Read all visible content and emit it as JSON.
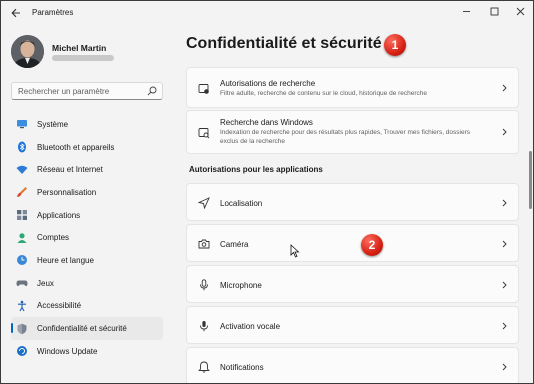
{
  "window": {
    "title": "Paramètres"
  },
  "user": {
    "name": "Michel Martin"
  },
  "search": {
    "placeholder": "Rechercher un paramètre"
  },
  "sidebar": {
    "items": [
      {
        "label": "Système",
        "icon": "monitor-icon"
      },
      {
        "label": "Bluetooth et appareils",
        "icon": "bluetooth-icon"
      },
      {
        "label": "Réseau et Internet",
        "icon": "wifi-icon"
      },
      {
        "label": "Personnalisation",
        "icon": "brush-icon"
      },
      {
        "label": "Applications",
        "icon": "apps-icon"
      },
      {
        "label": "Comptes",
        "icon": "account-icon"
      },
      {
        "label": "Heure et langue",
        "icon": "globe-clock-icon"
      },
      {
        "label": "Jeux",
        "icon": "gamepad-icon"
      },
      {
        "label": "Accessibilité",
        "icon": "accessibility-icon"
      },
      {
        "label": "Confidentialité et sécurité",
        "icon": "shield-icon",
        "active": true
      },
      {
        "label": "Windows Update",
        "icon": "update-icon"
      }
    ]
  },
  "main": {
    "title": "Confidentialité et sécurité",
    "top_cards": [
      {
        "title": "Autorisations de recherche",
        "subtitle": "Filtre adulte, recherche de contenu sur le cloud, historique de recherche",
        "icon": "search-permissions-icon"
      },
      {
        "title": "Recherche dans Windows",
        "subtitle": "Indexation de recherche pour des résultats plus rapides, Trouver mes fichiers, dossiers exclus de la recherche",
        "icon": "search-windows-icon"
      }
    ],
    "section_header": "Autorisations pour les applications",
    "app_permissions": [
      {
        "title": "Localisation",
        "icon": "location-icon"
      },
      {
        "title": "Caméra",
        "icon": "camera-icon"
      },
      {
        "title": "Microphone",
        "icon": "microphone-icon"
      },
      {
        "title": "Activation vocale",
        "icon": "voice-activation-icon"
      },
      {
        "title": "Notifications",
        "icon": "bell-icon"
      }
    ]
  },
  "annotations": {
    "badge1": "1",
    "badge2": "2"
  },
  "colors": {
    "accent": "#0067c0",
    "badge": "#d11e10",
    "background": "#f3f3f3",
    "card": "#fbfbfb"
  }
}
